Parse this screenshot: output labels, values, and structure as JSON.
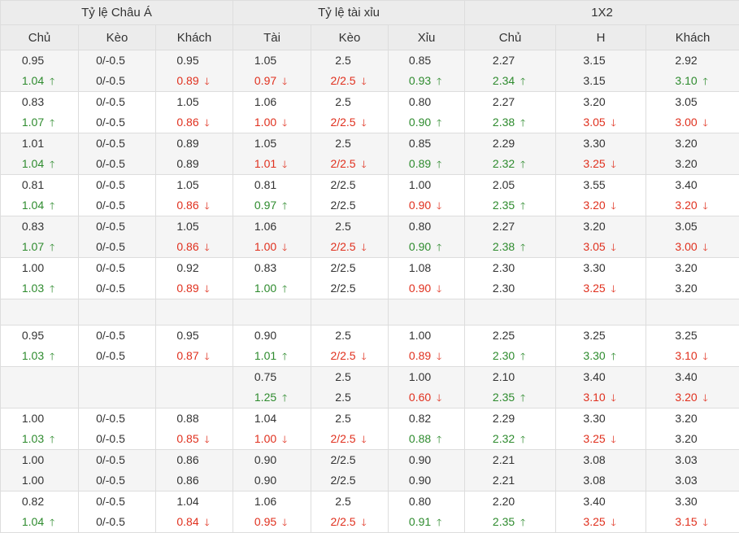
{
  "headers": {
    "groups": [
      "Tỷ lệ Châu Á",
      "Tỷ lệ tài xỉu",
      "1X2"
    ],
    "columns": [
      "Chủ",
      "Kèo",
      "Khách",
      "Tài",
      "Kèo",
      "Xỉu",
      "Chủ",
      "H",
      "Khách"
    ]
  },
  "arrows": {
    "up": "🡑",
    "down": "🡓"
  },
  "colors": {
    "up": "#2e8b2e",
    "down": "#e0301e",
    "header_bg": "#ececec",
    "alt_bg": "#f5f5f5",
    "border": "#dddddd"
  },
  "rows": [
    {
      "cells": [
        [
          {
            "v": "0.95",
            "d": ""
          },
          {
            "v": "1.04",
            "d": "up"
          }
        ],
        [
          {
            "v": "0/-0.5",
            "d": ""
          },
          {
            "v": "0/-0.5",
            "d": ""
          }
        ],
        [
          {
            "v": "0.95",
            "d": ""
          },
          {
            "v": "0.89",
            "d": "down"
          }
        ],
        [
          {
            "v": "1.05",
            "d": ""
          },
          {
            "v": "0.97",
            "d": "down"
          }
        ],
        [
          {
            "v": "2.5",
            "d": ""
          },
          {
            "v": "2/2.5",
            "d": "down"
          }
        ],
        [
          {
            "v": "0.85",
            "d": ""
          },
          {
            "v": "0.93",
            "d": "up"
          }
        ],
        [
          {
            "v": "2.27",
            "d": ""
          },
          {
            "v": "2.34",
            "d": "up"
          }
        ],
        [
          {
            "v": "3.15",
            "d": ""
          },
          {
            "v": "3.15",
            "d": ""
          }
        ],
        [
          {
            "v": "2.92",
            "d": ""
          },
          {
            "v": "3.10",
            "d": "up"
          }
        ]
      ]
    },
    {
      "cells": [
        [
          {
            "v": "0.83",
            "d": ""
          },
          {
            "v": "1.07",
            "d": "up"
          }
        ],
        [
          {
            "v": "0/-0.5",
            "d": ""
          },
          {
            "v": "0/-0.5",
            "d": ""
          }
        ],
        [
          {
            "v": "1.05",
            "d": ""
          },
          {
            "v": "0.86",
            "d": "down"
          }
        ],
        [
          {
            "v": "1.06",
            "d": ""
          },
          {
            "v": "1.00",
            "d": "down"
          }
        ],
        [
          {
            "v": "2.5",
            "d": ""
          },
          {
            "v": "2/2.5",
            "d": "down"
          }
        ],
        [
          {
            "v": "0.80",
            "d": ""
          },
          {
            "v": "0.90",
            "d": "up"
          }
        ],
        [
          {
            "v": "2.27",
            "d": ""
          },
          {
            "v": "2.38",
            "d": "up"
          }
        ],
        [
          {
            "v": "3.20",
            "d": ""
          },
          {
            "v": "3.05",
            "d": "down"
          }
        ],
        [
          {
            "v": "3.05",
            "d": ""
          },
          {
            "v": "3.00",
            "d": "down"
          }
        ]
      ]
    },
    {
      "cells": [
        [
          {
            "v": "1.01",
            "d": ""
          },
          {
            "v": "1.04",
            "d": "up"
          }
        ],
        [
          {
            "v": "0/-0.5",
            "d": ""
          },
          {
            "v": "0/-0.5",
            "d": ""
          }
        ],
        [
          {
            "v": "0.89",
            "d": ""
          },
          {
            "v": "0.89",
            "d": ""
          }
        ],
        [
          {
            "v": "1.05",
            "d": ""
          },
          {
            "v": "1.01",
            "d": "down"
          }
        ],
        [
          {
            "v": "2.5",
            "d": ""
          },
          {
            "v": "2/2.5",
            "d": "down"
          }
        ],
        [
          {
            "v": "0.85",
            "d": ""
          },
          {
            "v": "0.89",
            "d": "up"
          }
        ],
        [
          {
            "v": "2.29",
            "d": ""
          },
          {
            "v": "2.32",
            "d": "up"
          }
        ],
        [
          {
            "v": "3.30",
            "d": ""
          },
          {
            "v": "3.25",
            "d": "down"
          }
        ],
        [
          {
            "v": "3.20",
            "d": ""
          },
          {
            "v": "3.20",
            "d": ""
          }
        ]
      ]
    },
    {
      "cells": [
        [
          {
            "v": "0.81",
            "d": ""
          },
          {
            "v": "1.04",
            "d": "up"
          }
        ],
        [
          {
            "v": "0/-0.5",
            "d": ""
          },
          {
            "v": "0/-0.5",
            "d": ""
          }
        ],
        [
          {
            "v": "1.05",
            "d": ""
          },
          {
            "v": "0.86",
            "d": "down"
          }
        ],
        [
          {
            "v": "0.81",
            "d": ""
          },
          {
            "v": "0.97",
            "d": "up"
          }
        ],
        [
          {
            "v": "2/2.5",
            "d": ""
          },
          {
            "v": "2/2.5",
            "d": ""
          }
        ],
        [
          {
            "v": "1.00",
            "d": ""
          },
          {
            "v": "0.90",
            "d": "down"
          }
        ],
        [
          {
            "v": "2.05",
            "d": ""
          },
          {
            "v": "2.35",
            "d": "up"
          }
        ],
        [
          {
            "v": "3.55",
            "d": ""
          },
          {
            "v": "3.20",
            "d": "down"
          }
        ],
        [
          {
            "v": "3.40",
            "d": ""
          },
          {
            "v": "3.20",
            "d": "down"
          }
        ]
      ]
    },
    {
      "cells": [
        [
          {
            "v": "0.83",
            "d": ""
          },
          {
            "v": "1.07",
            "d": "up"
          }
        ],
        [
          {
            "v": "0/-0.5",
            "d": ""
          },
          {
            "v": "0/-0.5",
            "d": ""
          }
        ],
        [
          {
            "v": "1.05",
            "d": ""
          },
          {
            "v": "0.86",
            "d": "down"
          }
        ],
        [
          {
            "v": "1.06",
            "d": ""
          },
          {
            "v": "1.00",
            "d": "down"
          }
        ],
        [
          {
            "v": "2.5",
            "d": ""
          },
          {
            "v": "2/2.5",
            "d": "down"
          }
        ],
        [
          {
            "v": "0.80",
            "d": ""
          },
          {
            "v": "0.90",
            "d": "up"
          }
        ],
        [
          {
            "v": "2.27",
            "d": ""
          },
          {
            "v": "2.38",
            "d": "up"
          }
        ],
        [
          {
            "v": "3.20",
            "d": ""
          },
          {
            "v": "3.05",
            "d": "down"
          }
        ],
        [
          {
            "v": "3.05",
            "d": ""
          },
          {
            "v": "3.00",
            "d": "down"
          }
        ]
      ]
    },
    {
      "cells": [
        [
          {
            "v": "1.00",
            "d": ""
          },
          {
            "v": "1.03",
            "d": "up"
          }
        ],
        [
          {
            "v": "0/-0.5",
            "d": ""
          },
          {
            "v": "0/-0.5",
            "d": ""
          }
        ],
        [
          {
            "v": "0.92",
            "d": ""
          },
          {
            "v": "0.89",
            "d": "down"
          }
        ],
        [
          {
            "v": "0.83",
            "d": ""
          },
          {
            "v": "1.00",
            "d": "up"
          }
        ],
        [
          {
            "v": "2/2.5",
            "d": ""
          },
          {
            "v": "2/2.5",
            "d": ""
          }
        ],
        [
          {
            "v": "1.08",
            "d": ""
          },
          {
            "v": "0.90",
            "d": "down"
          }
        ],
        [
          {
            "v": "2.30",
            "d": ""
          },
          {
            "v": "2.30",
            "d": ""
          }
        ],
        [
          {
            "v": "3.30",
            "d": ""
          },
          {
            "v": "3.25",
            "d": "down"
          }
        ],
        [
          {
            "v": "3.20",
            "d": ""
          },
          {
            "v": "3.20",
            "d": ""
          }
        ]
      ]
    },
    {
      "empty": true
    },
    {
      "cells": [
        [
          {
            "v": "0.95",
            "d": ""
          },
          {
            "v": "1.03",
            "d": "up"
          }
        ],
        [
          {
            "v": "0/-0.5",
            "d": ""
          },
          {
            "v": "0/-0.5",
            "d": ""
          }
        ],
        [
          {
            "v": "0.95",
            "d": ""
          },
          {
            "v": "0.87",
            "d": "down"
          }
        ],
        [
          {
            "v": "0.90",
            "d": ""
          },
          {
            "v": "1.01",
            "d": "up"
          }
        ],
        [
          {
            "v": "2.5",
            "d": ""
          },
          {
            "v": "2/2.5",
            "d": "down"
          }
        ],
        [
          {
            "v": "1.00",
            "d": ""
          },
          {
            "v": "0.89",
            "d": "down"
          }
        ],
        [
          {
            "v": "2.25",
            "d": ""
          },
          {
            "v": "2.30",
            "d": "up"
          }
        ],
        [
          {
            "v": "3.25",
            "d": ""
          },
          {
            "v": "3.30",
            "d": "up"
          }
        ],
        [
          {
            "v": "3.25",
            "d": ""
          },
          {
            "v": "3.10",
            "d": "down"
          }
        ]
      ]
    },
    {
      "cells": [
        [],
        [],
        [],
        [
          {
            "v": "0.75",
            "d": ""
          },
          {
            "v": "1.25",
            "d": "up"
          }
        ],
        [
          {
            "v": "2.5",
            "d": ""
          },
          {
            "v": "2.5",
            "d": ""
          }
        ],
        [
          {
            "v": "1.00",
            "d": ""
          },
          {
            "v": "0.60",
            "d": "down"
          }
        ],
        [
          {
            "v": "2.10",
            "d": ""
          },
          {
            "v": "2.35",
            "d": "up"
          }
        ],
        [
          {
            "v": "3.40",
            "d": ""
          },
          {
            "v": "3.10",
            "d": "down"
          }
        ],
        [
          {
            "v": "3.40",
            "d": ""
          },
          {
            "v": "3.20",
            "d": "down"
          }
        ]
      ]
    },
    {
      "cells": [
        [
          {
            "v": "1.00",
            "d": ""
          },
          {
            "v": "1.03",
            "d": "up"
          }
        ],
        [
          {
            "v": "0/-0.5",
            "d": ""
          },
          {
            "v": "0/-0.5",
            "d": ""
          }
        ],
        [
          {
            "v": "0.88",
            "d": ""
          },
          {
            "v": "0.85",
            "d": "down"
          }
        ],
        [
          {
            "v": "1.04",
            "d": ""
          },
          {
            "v": "1.00",
            "d": "down"
          }
        ],
        [
          {
            "v": "2.5",
            "d": ""
          },
          {
            "v": "2/2.5",
            "d": "down"
          }
        ],
        [
          {
            "v": "0.82",
            "d": ""
          },
          {
            "v": "0.88",
            "d": "up"
          }
        ],
        [
          {
            "v": "2.29",
            "d": ""
          },
          {
            "v": "2.32",
            "d": "up"
          }
        ],
        [
          {
            "v": "3.30",
            "d": ""
          },
          {
            "v": "3.25",
            "d": "down"
          }
        ],
        [
          {
            "v": "3.20",
            "d": ""
          },
          {
            "v": "3.20",
            "d": ""
          }
        ]
      ]
    },
    {
      "cells": [
        [
          {
            "v": "1.00",
            "d": ""
          },
          {
            "v": "1.00",
            "d": ""
          }
        ],
        [
          {
            "v": "0/-0.5",
            "d": ""
          },
          {
            "v": "0/-0.5",
            "d": ""
          }
        ],
        [
          {
            "v": "0.86",
            "d": ""
          },
          {
            "v": "0.86",
            "d": ""
          }
        ],
        [
          {
            "v": "0.90",
            "d": ""
          },
          {
            "v": "0.90",
            "d": ""
          }
        ],
        [
          {
            "v": "2/2.5",
            "d": ""
          },
          {
            "v": "2/2.5",
            "d": ""
          }
        ],
        [
          {
            "v": "0.90",
            "d": ""
          },
          {
            "v": "0.90",
            "d": ""
          }
        ],
        [
          {
            "v": "2.21",
            "d": ""
          },
          {
            "v": "2.21",
            "d": ""
          }
        ],
        [
          {
            "v": "3.08",
            "d": ""
          },
          {
            "v": "3.08",
            "d": ""
          }
        ],
        [
          {
            "v": "3.03",
            "d": ""
          },
          {
            "v": "3.03",
            "d": ""
          }
        ]
      ]
    },
    {
      "cells": [
        [
          {
            "v": "0.82",
            "d": ""
          },
          {
            "v": "1.04",
            "d": "up"
          }
        ],
        [
          {
            "v": "0/-0.5",
            "d": ""
          },
          {
            "v": "0/-0.5",
            "d": ""
          }
        ],
        [
          {
            "v": "1.04",
            "d": ""
          },
          {
            "v": "0.84",
            "d": "down"
          }
        ],
        [
          {
            "v": "1.06",
            "d": ""
          },
          {
            "v": "0.95",
            "d": "down"
          }
        ],
        [
          {
            "v": "2.5",
            "d": ""
          },
          {
            "v": "2/2.5",
            "d": "down"
          }
        ],
        [
          {
            "v": "0.80",
            "d": ""
          },
          {
            "v": "0.91",
            "d": "up"
          }
        ],
        [
          {
            "v": "2.20",
            "d": ""
          },
          {
            "v": "2.35",
            "d": "up"
          }
        ],
        [
          {
            "v": "3.40",
            "d": ""
          },
          {
            "v": "3.25",
            "d": "down"
          }
        ],
        [
          {
            "v": "3.30",
            "d": ""
          },
          {
            "v": "3.15",
            "d": "down"
          }
        ]
      ]
    }
  ]
}
